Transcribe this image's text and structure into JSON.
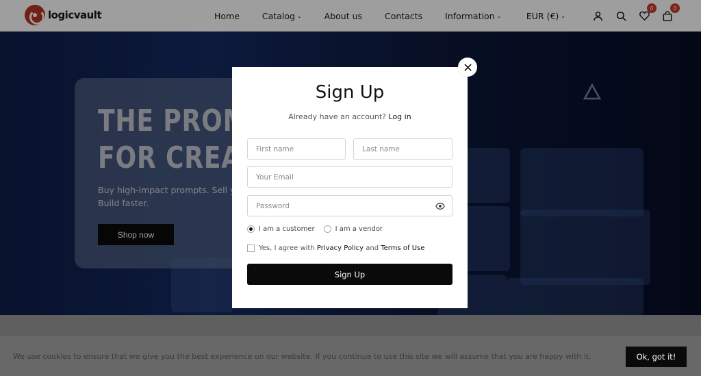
{
  "brand": {
    "logo_text": "logicvault",
    "accent": "#b83222"
  },
  "nav": {
    "items": [
      {
        "label": "Home",
        "dropdown": false
      },
      {
        "label": "Catalog",
        "dropdown": true
      },
      {
        "label": "About us",
        "dropdown": false
      },
      {
        "label": "Contacts",
        "dropdown": false
      },
      {
        "label": "Information",
        "dropdown": true
      }
    ],
    "currency": "EUR (€)",
    "wishlist_count": "0",
    "cart_count": "0",
    "icons": [
      "user-icon",
      "search-icon",
      "heart-icon",
      "bag-icon"
    ]
  },
  "hero": {
    "title_line1": "THE PROMPT",
    "title_line2": "FOR CREATO",
    "subtitle_line1": "Buy high-impact prompts. Sell y",
    "subtitle_line2": "Build faster.",
    "cta_label": "Shop now"
  },
  "modal": {
    "title": "Sign Up",
    "have_account_text": "Already have an account?",
    "login_link": "Log in",
    "first_name_placeholder": "First name",
    "last_name_placeholder": "Last name",
    "email_placeholder": "Your Email",
    "password_placeholder": "Password",
    "role_options": [
      {
        "label": "I am a customer",
        "checked": true
      },
      {
        "label": "I am a vendor",
        "checked": false
      }
    ],
    "agree_prefix": "Yes, I agree with",
    "privacy_link": "Privacy Policy",
    "agree_and": "and",
    "terms_link": "Terms of Use",
    "submit_label": "Sign Up"
  },
  "cookie": {
    "message": "We use cookies to ensure that we give you the best experience on our website. If you continue to use this site we will assume that you are happy with it.",
    "button_label": "Ok, got it!"
  }
}
